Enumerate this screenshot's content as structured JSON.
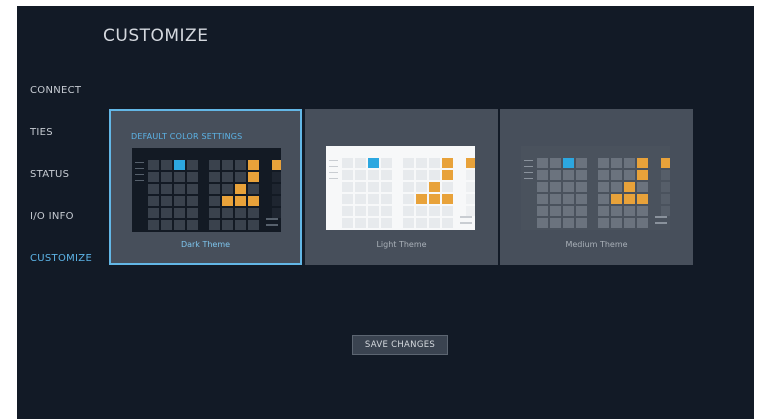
{
  "page": {
    "title": "CUSTOMIZE"
  },
  "nav": {
    "items": [
      {
        "label": "CONNECT",
        "active": false
      },
      {
        "label": "TIES",
        "active": false
      },
      {
        "label": "STATUS",
        "active": false
      },
      {
        "label": "I/O INFO",
        "active": false
      },
      {
        "label": "CUSTOMIZE",
        "active": true
      }
    ]
  },
  "section": {
    "label": "DEFAULT COLOR SETTINGS"
  },
  "themes": [
    {
      "name": "Dark Theme",
      "selected": true
    },
    {
      "name": "Light Theme",
      "selected": false
    },
    {
      "name": "Medium Theme",
      "selected": false
    }
  ],
  "actions": {
    "save_label": "SAVE CHANGES"
  },
  "colors": {
    "app_bg": "#121a26",
    "accent": "#5cb3e6",
    "card_bg": "#474f5b",
    "tie_orange": "#e8a23a",
    "tie_blue": "#2ca7e0"
  }
}
